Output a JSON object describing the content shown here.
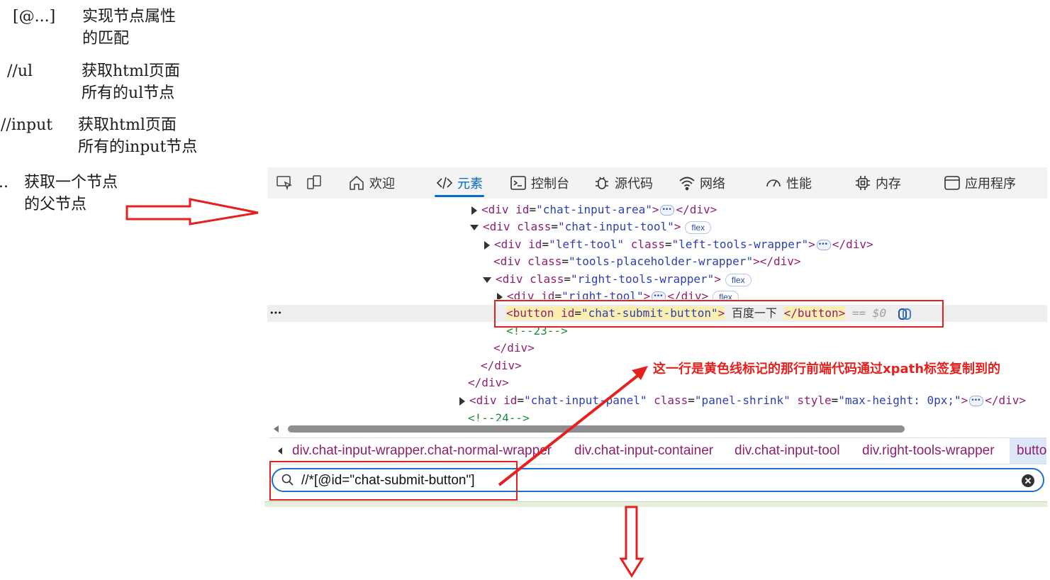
{
  "notes": [
    {
      "key": "[@...]",
      "desc_line1": "实现节点属性",
      "desc_line2": "的匹配"
    },
    {
      "key": "//ul",
      "desc_line1": "获取html页面",
      "desc_line2": "所有的ul节点"
    },
    {
      "key": "//input",
      "desc_line1": "获取html页面",
      "desc_line2": "所有的input节点"
    },
    {
      "key": "..",
      "desc_line1": "获取一个节点",
      "desc_line2": "的父节点"
    }
  ],
  "toolbar": {
    "tabs": [
      {
        "label": "欢迎",
        "icon": "home-icon"
      },
      {
        "label": "元素",
        "icon": "code-icon",
        "active": true
      },
      {
        "label": "控制台",
        "icon": "console-icon"
      },
      {
        "label": "源代码",
        "icon": "bug-icon"
      },
      {
        "label": "网络",
        "icon": "wifi-icon"
      },
      {
        "label": "性能",
        "icon": "gauge-icon"
      },
      {
        "label": "内存",
        "icon": "chip-icon"
      },
      {
        "label": "应用程序",
        "icon": "window-icon"
      }
    ]
  },
  "dom_tree": {
    "line1": {
      "tag_open": "<div",
      "attr1": "id",
      "val1": "\"chat-input-area\"",
      "close": ">",
      "end_tag": "</div>"
    },
    "line2": {
      "tag_open": "<div",
      "attr1": "class",
      "val1": "\"chat-input-tool\"",
      "close": ">",
      "badge": "flex"
    },
    "line3": {
      "tag_open": "<div",
      "attr1": "id",
      "val1": "\"left-tool\"",
      "attr2": "class",
      "val2": "\"left-tools-wrapper\"",
      "close": ">",
      "end_tag": "</div>"
    },
    "line4": {
      "tag_open": "<div",
      "attr1": "class",
      "val1": "\"tools-placeholder-wrapper\"",
      "close": "></div>"
    },
    "line5": {
      "tag_open": "<div",
      "attr1": "class",
      "val1": "\"right-tools-wrapper\"",
      "close": ">",
      "badge": "flex"
    },
    "line6": {
      "tag_open": "<div",
      "attr1": "id",
      "val1": "\"right-tool\"",
      "close": ">",
      "end_tag": "</div>",
      "badge": "flex"
    },
    "line7": {
      "tag_open": "<button",
      "attr1": "id",
      "val1": "\"chat-submit-button\"",
      "close": ">",
      "text": " 百度一下 ",
      "end_tag": "</button>",
      "eq": "== $0"
    },
    "line8": {
      "comment": "<!--23-->"
    },
    "line9": {
      "end_tag": "</div>"
    },
    "line10": {
      "end_tag": "</div>"
    },
    "line11": {
      "end_tag": "</div>"
    },
    "line12": {
      "tag_open": "<div",
      "attr1": "id",
      "val1": "\"chat-input-panel\"",
      "attr2": "class",
      "val2": "\"panel-shrink\"",
      "attr3": "style",
      "val3": "\"max-height: 0px;\"",
      "close": ">",
      "end_tag": "</div>"
    },
    "line13": {
      "comment": "<!--24-->"
    },
    "row_menu": "•••"
  },
  "breadcrumbs": [
    "div.chat-input-wrapper.chat-normal-wrapper",
    "div.chat-input-container",
    "div.chat-input-tool",
    "div.right-tools-wrapper",
    "button"
  ],
  "search": {
    "value": "//*[@id=\"chat-submit-button\"]"
  },
  "annotation": {
    "callout": "这一行是黄色线标记的那行前端代码通过xpath标签复制到的",
    "color": "#e3211e"
  }
}
